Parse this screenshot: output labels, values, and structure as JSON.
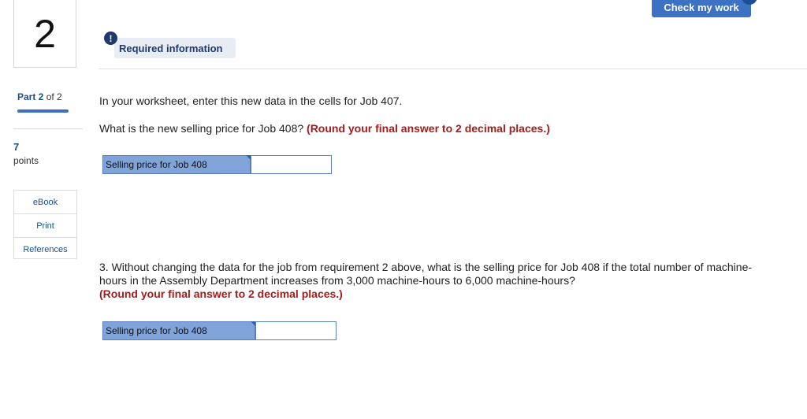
{
  "question": {
    "number": "2"
  },
  "part": {
    "current": "Part 2",
    "total": "of 2"
  },
  "points": {
    "value": "7",
    "label": "points"
  },
  "tools": [
    "eBook",
    "Print",
    "References"
  ],
  "header": {
    "check_label": "Check my work",
    "required_label": "Required information",
    "required_icon": "exclamation-icon"
  },
  "main": {
    "p1": "In your worksheet, enter this new data in the cells for Job 407.",
    "p2_text": "What is the new selling price for Job 408? ",
    "p2_note": "(Round your final answer to 2 decimal places.)",
    "row1": {
      "label": "Selling price for Job 408",
      "value": ""
    },
    "p3_text": "3. Without changing the data for the job from requirement 2 above, what is the selling price for Job 408 if the total number of machine-hours in the Assembly Department increases from 3,000 machine-hours to 6,000 machine-hours?",
    "p3_note": "(Round your final answer to 2 decimal places.)",
    "row2": {
      "label": "Selling price for Job 408",
      "value": ""
    }
  },
  "colors": {
    "accent": "#3c71c4",
    "note_red": "#a51c1c",
    "label_cell": "#80a4d9"
  }
}
